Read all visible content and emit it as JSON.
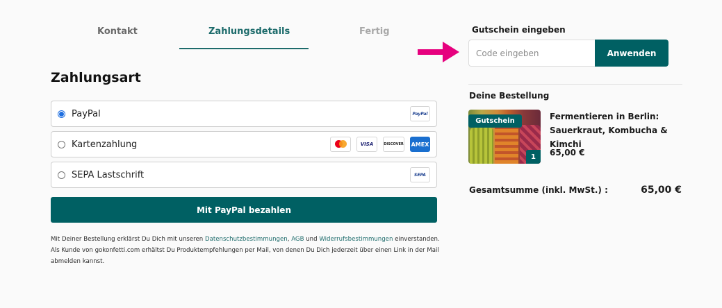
{
  "steps": [
    {
      "label": "Kontakt",
      "state": "done"
    },
    {
      "label": "Zahlungsdetails",
      "state": "active"
    },
    {
      "label": "Fertig",
      "state": "pending"
    }
  ],
  "payment": {
    "title": "Zahlungsart",
    "options": [
      {
        "label": "PayPal",
        "selected": true,
        "logos": [
          "PayPal"
        ]
      },
      {
        "label": "Kartenzahlung",
        "selected": false,
        "logos": [
          "Mastercard",
          "VISA",
          "DISCOVER",
          "AMEX"
        ]
      },
      {
        "label": "SEPA Lastschrift",
        "selected": false,
        "logos": [
          "SEPA"
        ]
      }
    ],
    "pay_button": "Mit PayPal bezahlen"
  },
  "legal": {
    "part1": "Mit Deiner Bestellung erklärst Du Dich mit unseren ",
    "link_privacy": "Datenschutzbestimmungen",
    "sep": ", ",
    "link_terms": "AGB",
    "and": " und ",
    "link_withdrawal": "Widerrufsbestimmungen",
    "part2": " einverstanden. Als Kunde von gokonfetti.com erhältst Du Produktempfehlungen per Mail, von denen Du Dich jederzeit über einen Link in der Mail abmelden kannst."
  },
  "coupon": {
    "label": "Gutschein eingeben",
    "placeholder": "Code eingeben",
    "button": "Anwenden"
  },
  "order": {
    "title": "Deine Bestellung",
    "item": {
      "badge": "Gutschein",
      "name": "Fermentieren in Berlin: Sauerkraut, Kombucha & Kimchi",
      "price": "65,00 €",
      "quantity": "1"
    },
    "total_label": "Gesamtsumme (inkl. MwSt.) :",
    "total_value": "65,00 €"
  },
  "colors": {
    "brand": "#006063",
    "accent_arrow": "#e6007e",
    "radio_selected": "#1f6fe0"
  },
  "icons": {
    "arrow": "pink-arrow-right-icon"
  }
}
